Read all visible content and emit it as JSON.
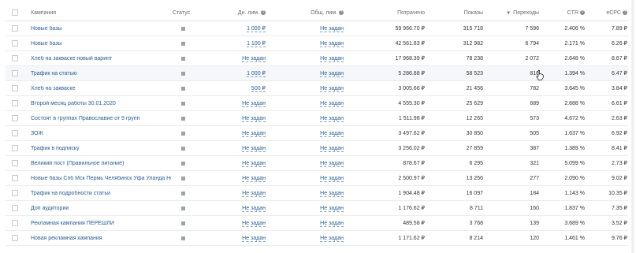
{
  "header": {
    "name": "Кампания",
    "status": "Статус",
    "day_limit": "Дн. лим.",
    "total_limit": "Общ. лим.",
    "spent": "Потрачено",
    "shows": "Показы",
    "clicks": "Переходы",
    "ctr": "CTR",
    "cpc": "eCPC"
  },
  "rows": [
    {
      "name": "Новые базы",
      "day_limit": "1 000 ₽",
      "total_limit": "Не задан",
      "spent": "59 966.70 ₽",
      "shows": "315 718",
      "clicks": "7 596",
      "ctr": "2.406 %",
      "cpc": "7.89 ₽"
    },
    {
      "name": "Новые базы",
      "day_limit": "1 100 ₽",
      "total_limit": "Не задан",
      "spent": "42 561.83 ₽",
      "shows": "312 982",
      "clicks": "6 794",
      "ctr": "2.171 %",
      "cpc": "6.26 ₽"
    },
    {
      "name": "Хлеб на закваске новый варинт",
      "day_limit": "Не задан",
      "total_limit": "Не задан",
      "spent": "17 968.39 ₽",
      "shows": "78 238",
      "clicks": "2 072",
      "ctr": "2.648 %",
      "cpc": "8.67 ₽"
    },
    {
      "name": "Трафик на статью",
      "day_limit": "1 000 ₽",
      "total_limit": "Не задан",
      "spent": "5 286.88 ₽",
      "shows": "58 523",
      "clicks": "816",
      "ctr": "1.394 %",
      "cpc": "6.47 ₽"
    },
    {
      "name": "Хлеб на закваске",
      "day_limit": "500 ₽",
      "total_limit": "Не задан",
      "spent": "3 005.66 ₽",
      "shows": "21 456",
      "clicks": "782",
      "ctr": "3.645 %",
      "cpc": "3.84 ₽"
    },
    {
      "name": "Второй месяц работы 30.01.2020",
      "day_limit": "Не задан",
      "total_limit": "Не задан",
      "spent": "4 555.30 ₽",
      "shows": "25 629",
      "clicks": "689",
      "ctr": "2.688 %",
      "cpc": "6.61 ₽"
    },
    {
      "name": "Состоят в группах Православие от 9 групп",
      "day_limit": "Не задан",
      "total_limit": "Не задан",
      "spent": "1 511.98 ₽",
      "shows": "12 265",
      "clicks": "573",
      "ctr": "4.672 %",
      "cpc": "2.63 ₽"
    },
    {
      "name": "ЗОЖ",
      "day_limit": "Не задан",
      "total_limit": "Не задан",
      "spent": "3 497.62 ₽",
      "shows": "30 850",
      "clicks": "505",
      "ctr": "1.637 %",
      "cpc": "6.92 ₽"
    },
    {
      "name": "Трафик в подписку",
      "day_limit": "Не задан",
      "total_limit": "Не задан",
      "spent": "3 256.02 ₽",
      "shows": "27 859",
      "clicks": "387",
      "ctr": "1.389 %",
      "cpc": "8.41 ₽"
    },
    {
      "name": "Великий пост (Правильное питание)",
      "day_limit": "Не задан",
      "total_limit": "Не задан",
      "spent": "878.67 ₽",
      "shows": "6 295",
      "clicks": "321",
      "ctr": "5.099 %",
      "cpc": "2.73 ₽"
    },
    {
      "name": "Новые базы Спб Мск Пермь Челябинск Уфа Уланда Новос...",
      "day_limit": "Не задан",
      "total_limit": "Не задан",
      "spent": "2 500.97 ₽",
      "shows": "13 256",
      "clicks": "277",
      "ctr": "2.090 %",
      "cpc": "9.02 ₽"
    },
    {
      "name": "Трафик на подробности статьи",
      "day_limit": "Не задан",
      "total_limit": "Не задан",
      "spent": "1 904.48 ₽",
      "shows": "16 097",
      "clicks": "184",
      "ctr": "1.143 %",
      "cpc": "10.35 ₽"
    },
    {
      "name": "Доп аудитории",
      "day_limit": "Не задан",
      "total_limit": "Не задан",
      "spent": "1 176.62 ₽",
      "shows": "8 711",
      "clicks": "160",
      "ctr": "1.837 %",
      "cpc": "7.35 ₽"
    },
    {
      "name": "Рекламная кампания ПЕРЕШЛИ",
      "day_limit": "Не задан",
      "total_limit": "Не задан",
      "spent": "489.58 ₽",
      "shows": "3 768",
      "clicks": "139",
      "ctr": "3.689 %",
      "cpc": "3.52 ₽"
    },
    {
      "name": "Новая рекламная кампания",
      "day_limit": "Не задан",
      "total_limit": "Не задан",
      "spent": "1 171.62 ₽",
      "shows": "8 214",
      "clicks": "120",
      "ctr": "1.461 %",
      "cpc": "9.76 ₽"
    }
  ],
  "icons": {
    "help": "question-circle-icon",
    "sort": "sort-desc-icon",
    "status": "status-square-icon"
  }
}
